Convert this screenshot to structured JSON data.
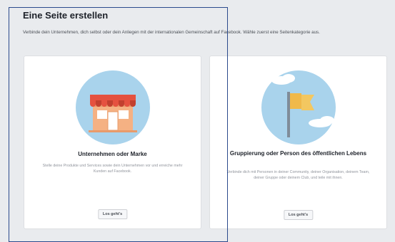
{
  "header": {
    "title": "Eine Seite erstellen",
    "subtitle": "Verbinde dein Unternehmen, dich selbst oder dein Anliegen mit der internationalen Gemeinschaft auf Facebook. Wähle zuerst eine Seitenkategorie aus."
  },
  "cards": [
    {
      "title": "Unternehmen oder Marke",
      "description": "Stelle deine Produkte und Services sowie dein Unternehmen vor und erreiche mehr Kunden auf Facebook.",
      "button_label": "Los geht's",
      "icon": "storefront-icon"
    },
    {
      "title": "Gruppierung oder Person des öffentlichen Lebens",
      "description": "Verbinde dich mit Personen in deiner Community, deiner Organisation, deinem Team, deiner Gruppe oder deinem Club, und teile mit ihnen.",
      "button_label": "Los geht's",
      "icon": "flag-icon"
    }
  ],
  "colors": {
    "background": "#e9ebee",
    "card": "#ffffff",
    "illustration_circle": "#a9d3ec",
    "awning_red": "#e5513f",
    "flag_yellow": "#f3c760",
    "selection_outline": "#2b4a8c"
  }
}
